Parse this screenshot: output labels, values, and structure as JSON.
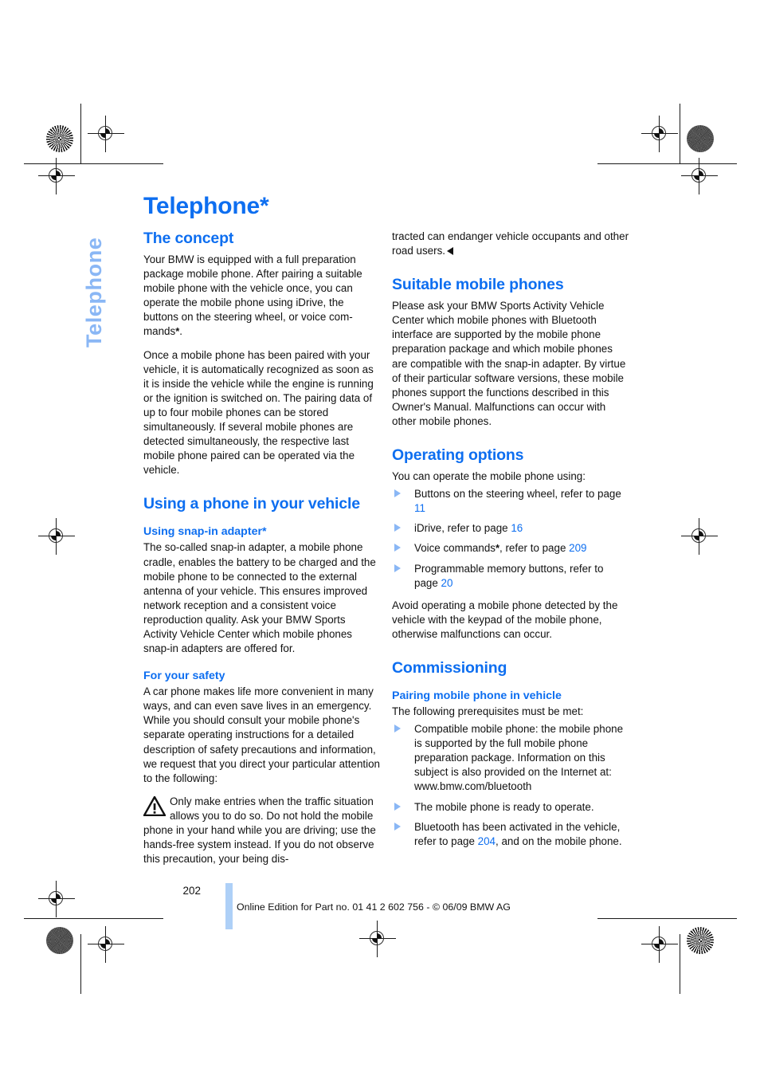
{
  "document": {
    "chapter_tab": "Telephone",
    "chapter_title": "Telephone*",
    "page_number": "202",
    "footer_text": "Online Edition for Part no. 01 41 2 602 756 - © 06/09 BMW AG",
    "accent_color": "#0d6ef0",
    "tab_color": "#8ab7f5",
    "footer_bar_color": "#aed0f7"
  },
  "left_column": {
    "concept": {
      "heading": "The concept",
      "para1_before": "Your BMW is equipped with a full preparation package mobile phone. After pairing a suitable mobile phone with the vehicle once, you can operate the mobile phone using iDrive, the buttons on the steering wheel, or voice com-mands",
      "para1_star": "*",
      "para1_after": ".",
      "para2": "Once a mobile phone has been paired with your vehicle, it is automatically recognized as soon as it is inside the vehicle while the engine is running or the ignition is switched on. The pairing data of up to four mobile phones can be stored simultaneously. If several mobile phones are detected simultaneously, the respective last mobile phone paired can be operated via the vehicle."
    },
    "using_phone": {
      "heading": "Using a phone in your vehicle",
      "snap_in": {
        "heading_text": "Using snap-in adapter",
        "heading_star": "*",
        "para": "The so-called snap-in adapter, a mobile phone cradle, enables the battery to be charged and the mobile phone to be connected to the external antenna of your vehicle. This ensures improved network reception and a consistent voice reproduction quality. Ask your BMW Sports Activity Vehicle Center which mobile phones snap-in adapters are offered for."
      },
      "safety": {
        "heading": "For your safety",
        "para": "A car phone makes life more convenient in many ways, and can even save lives in an emergency. While you should consult your mobile phone's separate operating instructions for a detailed description of safety precautions and information, we request that you direct your particular attention to the following:",
        "warning_icon": "warning-triangle-icon",
        "warning_text": "Only make entries when the traffic situation allows you to do so. Do not hold the mobile phone in your hand while you are driving; use the hands-free system instead. If you do not observe this precaution, your being dis-"
      }
    }
  },
  "right_column": {
    "warning_continued": "tracted can endanger vehicle occupants and other road users.",
    "suitable_phones": {
      "heading": "Suitable mobile phones",
      "para": "Please ask your BMW Sports Activity Vehicle Center which mobile phones with Bluetooth interface are supported by the mobile phone preparation package and which mobile phones are compatible with the snap-in adapter. By virtue of their particular software versions, these mobile phones support the functions described in this Owner's Manual. Malfunctions can occur with other mobile phones."
    },
    "operating_options": {
      "heading": "Operating options",
      "intro": "You can operate the mobile phone using:",
      "items": [
        {
          "text_before": "Buttons on the steering wheel, refer to page ",
          "page_ref": "11",
          "text_after": "",
          "star": ""
        },
        {
          "text_before": "iDrive, refer to page ",
          "page_ref": "16",
          "text_after": "",
          "star": ""
        },
        {
          "text_before": "Voice commands",
          "page_ref": "209",
          "text_after": ", refer to page ",
          "star": "*"
        },
        {
          "text_before": "Programmable memory buttons, refer to page ",
          "page_ref": "20",
          "text_after": "",
          "star": ""
        }
      ],
      "closing_para": "Avoid operating a mobile phone detected by the vehicle with the keypad of the mobile phone, otherwise malfunctions can occur."
    },
    "commissioning": {
      "heading": "Commissioning",
      "pairing": {
        "heading": "Pairing mobile phone in vehicle",
        "intro": "The following prerequisites must be met:",
        "items": [
          {
            "text_before": "Compatible mobile phone: the mobile phone is supported by the full mobile phone preparation package. Information on this subject is also provided on the Internet at: www.bmw.com/bluetooth",
            "page_ref": "",
            "text_after": ""
          },
          {
            "text_before": "The mobile phone is ready to operate.",
            "page_ref": "",
            "text_after": ""
          },
          {
            "text_before": "Bluetooth has been activated in the vehicle, refer to page ",
            "page_ref": "204",
            "text_after": ", and on the mobile phone."
          }
        ]
      }
    }
  }
}
